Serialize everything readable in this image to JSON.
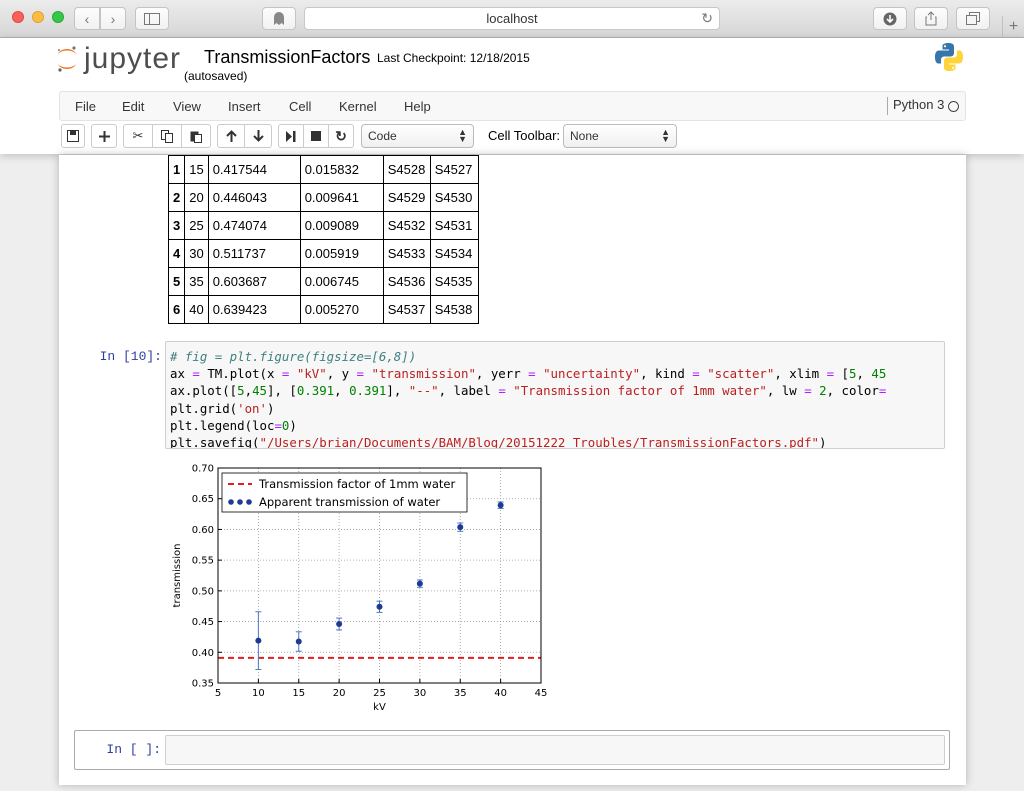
{
  "browser": {
    "url": "localhost",
    "new_tab_icon": "+"
  },
  "header": {
    "logo_text": "jupyter",
    "notebook_name": "TransmissionFactors",
    "checkpoint": "Last Checkpoint: 12/18/2015",
    "autosaved": "(autosaved)"
  },
  "menu": {
    "items": [
      "File",
      "Edit",
      "View",
      "Insert",
      "Cell",
      "Kernel",
      "Help"
    ],
    "kernel_name": "Python 3"
  },
  "toolbar": {
    "cell_type": "Code",
    "cell_toolbar_label": "Cell Toolbar:",
    "cell_toolbar_value": "None"
  },
  "dataframe": {
    "rows": [
      [
        "1",
        "15",
        "0.417544",
        "0.015832",
        "S4528",
        "S4527"
      ],
      [
        "2",
        "20",
        "0.446043",
        "0.009641",
        "S4529",
        "S4530"
      ],
      [
        "3",
        "25",
        "0.474074",
        "0.009089",
        "S4532",
        "S4531"
      ],
      [
        "4",
        "30",
        "0.511737",
        "0.005919",
        "S4533",
        "S4534"
      ],
      [
        "5",
        "35",
        "0.603687",
        "0.006745",
        "S4536",
        "S4535"
      ],
      [
        "6",
        "40",
        "0.639423",
        "0.005270",
        "S4537",
        "S4538"
      ]
    ]
  },
  "cell10": {
    "prompt": "In [10]:"
  },
  "empty_cell": {
    "prompt": "In [ ]:"
  },
  "chart_data": {
    "type": "scatter",
    "xlabel": "kV",
    "ylabel": "transmission",
    "xlim": [
      5,
      45
    ],
    "ylim": [
      0.35,
      0.7
    ],
    "xticks": [
      "5",
      "10",
      "15",
      "20",
      "25",
      "30",
      "35",
      "40",
      "45"
    ],
    "yticks": [
      "0.35",
      "0.40",
      "0.45",
      "0.50",
      "0.55",
      "0.60",
      "0.65",
      "0.70"
    ],
    "grid": true,
    "legend_position": "upper-left",
    "series": [
      {
        "name": "Apparent transmission of water",
        "type": "scatter-errorbar",
        "color": "#1f3a93",
        "x": [
          10,
          15,
          20,
          25,
          30,
          35,
          40
        ],
        "y": [
          0.419,
          0.417544,
          0.446043,
          0.474074,
          0.511737,
          0.603687,
          0.639423
        ],
        "yerr": [
          0.047,
          0.015832,
          0.009641,
          0.009089,
          0.005919,
          0.006745,
          0.00527
        ]
      },
      {
        "name": "Transmission factor of 1mm water",
        "type": "hline-dashed",
        "color": "#e02020",
        "x": [
          5,
          45
        ],
        "y": [
          0.391,
          0.391
        ]
      }
    ]
  }
}
